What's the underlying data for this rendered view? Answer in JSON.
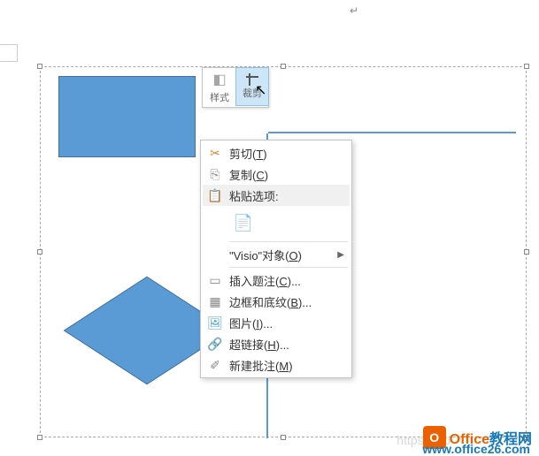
{
  "paragraph_mark": "↵",
  "mini_toolbar": {
    "style_label": "样式",
    "crop_label": "裁剪"
  },
  "context_menu": {
    "cut": "剪切(T)",
    "copy": "复制(C)",
    "paste_options": "粘贴选项:",
    "visio_object": "\"Visio\"对象(O)",
    "insert_caption": "插入题注(C)...",
    "borders_shading": "边框和底纹(B)...",
    "picture": "图片(I)...",
    "hyperlink": "超链接(H)...",
    "new_comment": "新建批注(M)"
  },
  "icons": {
    "cut": "✂",
    "copy": "⎘",
    "paste": "📋",
    "paste_opt": "📄",
    "caption": "▭",
    "border": "▦",
    "picture": "🖼",
    "link": "🔗",
    "comment": "✐"
  },
  "watermark": "https://blo",
  "logo": {
    "brand1": "Office",
    "brand2": "教程网",
    "url": "www.office26.com"
  },
  "chart_data": {
    "type": "diagram",
    "shapes": [
      {
        "kind": "rectangle",
        "fill": "#5b9bd5"
      },
      {
        "kind": "diamond",
        "fill": "#5b9bd5"
      },
      {
        "kind": "connector",
        "orientation": "vertical"
      },
      {
        "kind": "connector",
        "orientation": "horizontal"
      }
    ]
  }
}
